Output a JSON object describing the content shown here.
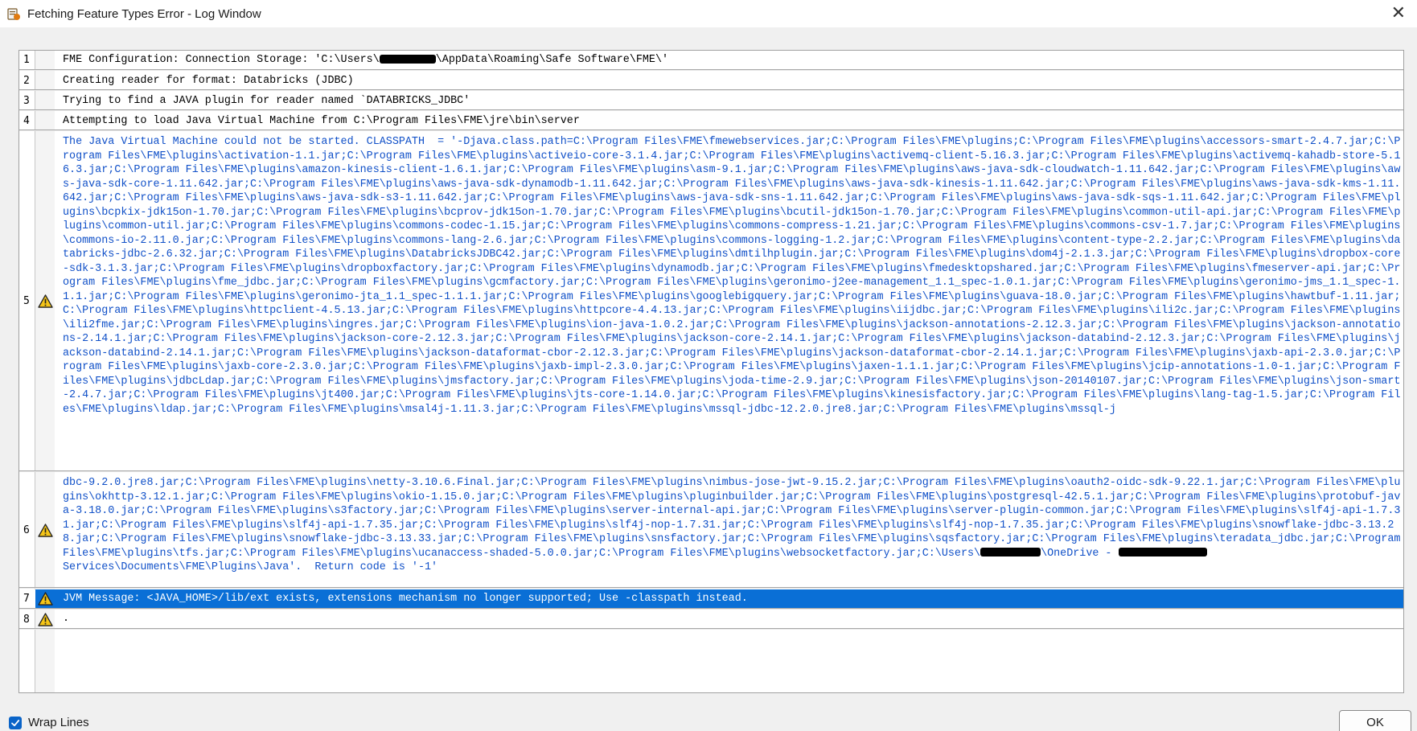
{
  "window": {
    "title": "Fetching Feature Types Error - Log Window",
    "close_glyph": "✕"
  },
  "log": {
    "rows": [
      {
        "num": "1",
        "icon": "",
        "text_before": "FME Configuration: Connection Storage: 'C:\\Users\\",
        "text_after": "\\AppData\\Roaming\\Safe Software\\FME\\'"
      },
      {
        "num": "2",
        "icon": "",
        "text": "Creating reader for format: Databricks (JDBC)"
      },
      {
        "num": "3",
        "icon": "",
        "text": "Trying to find a JAVA plugin for reader named `DATABRICKS_JDBC'"
      },
      {
        "num": "4",
        "icon": "",
        "text": "Attempting to load Java Virtual Machine from C:\\Program Files\\FME\\jre\\bin\\server"
      },
      {
        "num": "5",
        "icon": "warning-icon",
        "text": "The Java Virtual Machine could not be started. CLASSPATH  = '-Djava.class.path=C:\\Program Files\\FME\\fmewebservices.jar;C:\\Program Files\\FME\\plugins;C:\\Program Files\\FME\\plugins\\accessors-smart-2.4.7.jar;C:\\Program Files\\FME\\plugins\\activation-1.1.jar;C:\\Program Files\\FME\\plugins\\activeio-core-3.1.4.jar;C:\\Program Files\\FME\\plugins\\activemq-client-5.16.3.jar;C:\\Program Files\\FME\\plugins\\activemq-kahadb-store-5.16.3.jar;C:\\Program Files\\FME\\plugins\\amazon-kinesis-client-1.6.1.jar;C:\\Program Files\\FME\\plugins\\asm-9.1.jar;C:\\Program Files\\FME\\plugins\\aws-java-sdk-cloudwatch-1.11.642.jar;C:\\Program Files\\FME\\plugins\\aws-java-sdk-core-1.11.642.jar;C:\\Program Files\\FME\\plugins\\aws-java-sdk-dynamodb-1.11.642.jar;C:\\Program Files\\FME\\plugins\\aws-java-sdk-kinesis-1.11.642.jar;C:\\Program Files\\FME\\plugins\\aws-java-sdk-kms-1.11.642.jar;C:\\Program Files\\FME\\plugins\\aws-java-sdk-s3-1.11.642.jar;C:\\Program Files\\FME\\plugins\\aws-java-sdk-sns-1.11.642.jar;C:\\Program Files\\FME\\plugins\\aws-java-sdk-sqs-1.11.642.jar;C:\\Program Files\\FME\\plugins\\bcpkix-jdk15on-1.70.jar;C:\\Program Files\\FME\\plugins\\bcprov-jdk15on-1.70.jar;C:\\Program Files\\FME\\plugins\\bcutil-jdk15on-1.70.jar;C:\\Program Files\\FME\\plugins\\common-util-api.jar;C:\\Program Files\\FME\\plugins\\common-util.jar;C:\\Program Files\\FME\\plugins\\commons-codec-1.15.jar;C:\\Program Files\\FME\\plugins\\commons-compress-1.21.jar;C:\\Program Files\\FME\\plugins\\commons-csv-1.7.jar;C:\\Program Files\\FME\\plugins\\commons-io-2.11.0.jar;C:\\Program Files\\FME\\plugins\\commons-lang-2.6.jar;C:\\Program Files\\FME\\plugins\\commons-logging-1.2.jar;C:\\Program Files\\FME\\plugins\\content-type-2.2.jar;C:\\Program Files\\FME\\plugins\\databricks-jdbc-2.6.32.jar;C:\\Program Files\\FME\\plugins\\DatabricksJDBC42.jar;C:\\Program Files\\FME\\plugins\\dmtilhplugin.jar;C:\\Program Files\\FME\\plugins\\dom4j-2.1.3.jar;C:\\Program Files\\FME\\plugins\\dropbox-core-sdk-3.1.3.jar;C:\\Program Files\\FME\\plugins\\dropboxfactory.jar;C:\\Program Files\\FME\\plugins\\dynamodb.jar;C:\\Program Files\\FME\\plugins\\fmedesktopshared.jar;C:\\Program Files\\FME\\plugins\\fmeserver-api.jar;C:\\Program Files\\FME\\plugins\\fme_jdbc.jar;C:\\Program Files\\FME\\plugins\\gcmfactory.jar;C:\\Program Files\\FME\\plugins\\geronimo-j2ee-management_1.1_spec-1.0.1.jar;C:\\Program Files\\FME\\plugins\\geronimo-jms_1.1_spec-1.1.1.jar;C:\\Program Files\\FME\\plugins\\geronimo-jta_1.1_spec-1.1.1.jar;C:\\Program Files\\FME\\plugins\\googlebigquery.jar;C:\\Program Files\\FME\\plugins\\guava-18.0.jar;C:\\Program Files\\FME\\plugins\\hawtbuf-1.11.jar;C:\\Program Files\\FME\\plugins\\httpclient-4.5.13.jar;C:\\Program Files\\FME\\plugins\\httpcore-4.4.13.jar;C:\\Program Files\\FME\\plugins\\iijdbc.jar;C:\\Program Files\\FME\\plugins\\ili2c.jar;C:\\Program Files\\FME\\plugins\\ili2fme.jar;C:\\Program Files\\FME\\plugins\\ingres.jar;C:\\Program Files\\FME\\plugins\\ion-java-1.0.2.jar;C:\\Program Files\\FME\\plugins\\jackson-annotations-2.12.3.jar;C:\\Program Files\\FME\\plugins\\jackson-annotations-2.14.1.jar;C:\\Program Files\\FME\\plugins\\jackson-core-2.12.3.jar;C:\\Program Files\\FME\\plugins\\jackson-core-2.14.1.jar;C:\\Program Files\\FME\\plugins\\jackson-databind-2.12.3.jar;C:\\Program Files\\FME\\plugins\\jackson-databind-2.14.1.jar;C:\\Program Files\\FME\\plugins\\jackson-dataformat-cbor-2.12.3.jar;C:\\Program Files\\FME\\plugins\\jackson-dataformat-cbor-2.14.1.jar;C:\\Program Files\\FME\\plugins\\jaxb-api-2.3.0.jar;C:\\Program Files\\FME\\plugins\\jaxb-core-2.3.0.jar;C:\\Program Files\\FME\\plugins\\jaxb-impl-2.3.0.jar;C:\\Program Files\\FME\\plugins\\jaxen-1.1.1.jar;C:\\Program Files\\FME\\plugins\\jcip-annotations-1.0-1.jar;C:\\Program Files\\FME\\plugins\\jdbcLdap.jar;C:\\Program Files\\FME\\plugins\\jmsfactory.jar;C:\\Program Files\\FME\\plugins\\joda-time-2.9.jar;C:\\Program Files\\FME\\plugins\\json-20140107.jar;C:\\Program Files\\FME\\plugins\\json-smart-2.4.7.jar;C:\\Program Files\\FME\\plugins\\jt400.jar;C:\\Program Files\\FME\\plugins\\jts-core-1.14.0.jar;C:\\Program Files\\FME\\plugins\\kinesisfactory.jar;C:\\Program Files\\FME\\plugins\\lang-tag-1.5.jar;C:\\Program Files\\FME\\plugins\\ldap.jar;C:\\Program Files\\FME\\plugins\\msal4j-1.11.3.jar;C:\\Program Files\\FME\\plugins\\mssql-jdbc-12.2.0.jre8.jar;C:\\Program Files\\FME\\plugins\\mssql-j"
      },
      {
        "num": "6",
        "icon": "warning-icon",
        "text_before": "dbc-9.2.0.jre8.jar;C:\\Program Files\\FME\\plugins\\netty-3.10.6.Final.jar;C:\\Program Files\\FME\\plugins\\nimbus-jose-jwt-9.15.2.jar;C:\\Program Files\\FME\\plugins\\oauth2-oidc-sdk-9.22.1.jar;C:\\Program Files\\FME\\plugins\\okhttp-3.12.1.jar;C:\\Program Files\\FME\\plugins\\okio-1.15.0.jar;C:\\Program Files\\FME\\plugins\\pluginbuilder.jar;C:\\Program Files\\FME\\plugins\\postgresql-42.5.1.jar;C:\\Program Files\\FME\\plugins\\protobuf-java-3.18.0.jar;C:\\Program Files\\FME\\plugins\\s3factory.jar;C:\\Program Files\\FME\\plugins\\server-internal-api.jar;C:\\Program Files\\FME\\plugins\\server-plugin-common.jar;C:\\Program Files\\FME\\plugins\\slf4j-api-1.7.31.jar;C:\\Program Files\\FME\\plugins\\slf4j-api-1.7.35.jar;C:\\Program Files\\FME\\plugins\\slf4j-nop-1.7.31.jar;C:\\Program Files\\FME\\plugins\\slf4j-nop-1.7.35.jar;C:\\Program Files\\FME\\plugins\\snowflake-jdbc-3.13.28.jar;C:\\Program Files\\FME\\plugins\\snowflake-jdbc-3.13.33.jar;C:\\Program Files\\FME\\plugins\\snsfactory.jar;C:\\Program Files\\FME\\plugins\\sqsfactory.jar;C:\\Program Files\\FME\\plugins\\teradata_jdbc.jar;C:\\Program Files\\FME\\plugins\\tfs.jar;C:\\Program Files\\FME\\plugins\\ucanaccess-shaded-5.0.0.jar;C:\\Program Files\\FME\\plugins\\websocketfactory.jar;C:\\Users\\",
        "text_mid": "\\OneDrive - ",
        "text_after": "Services\\Documents\\FME\\Plugins\\Java'.  Return code is '-1'"
      },
      {
        "num": "7",
        "icon": "warning-icon",
        "text": "JVM Message: <JAVA_HOME>/lib/ext exists, extensions mechanism no longer supported; Use -classpath instead.",
        "selected": true
      },
      {
        "num": "8",
        "icon": "warning-icon",
        "text": "."
      }
    ]
  },
  "footer": {
    "wrap_lines_label": "Wrap Lines",
    "wrap_lines_checked": true,
    "ok_label": "OK"
  },
  "colors": {
    "selection": "#0a6fd6",
    "warning_text": "#1050c8",
    "warning_icon": "#f5c518"
  }
}
